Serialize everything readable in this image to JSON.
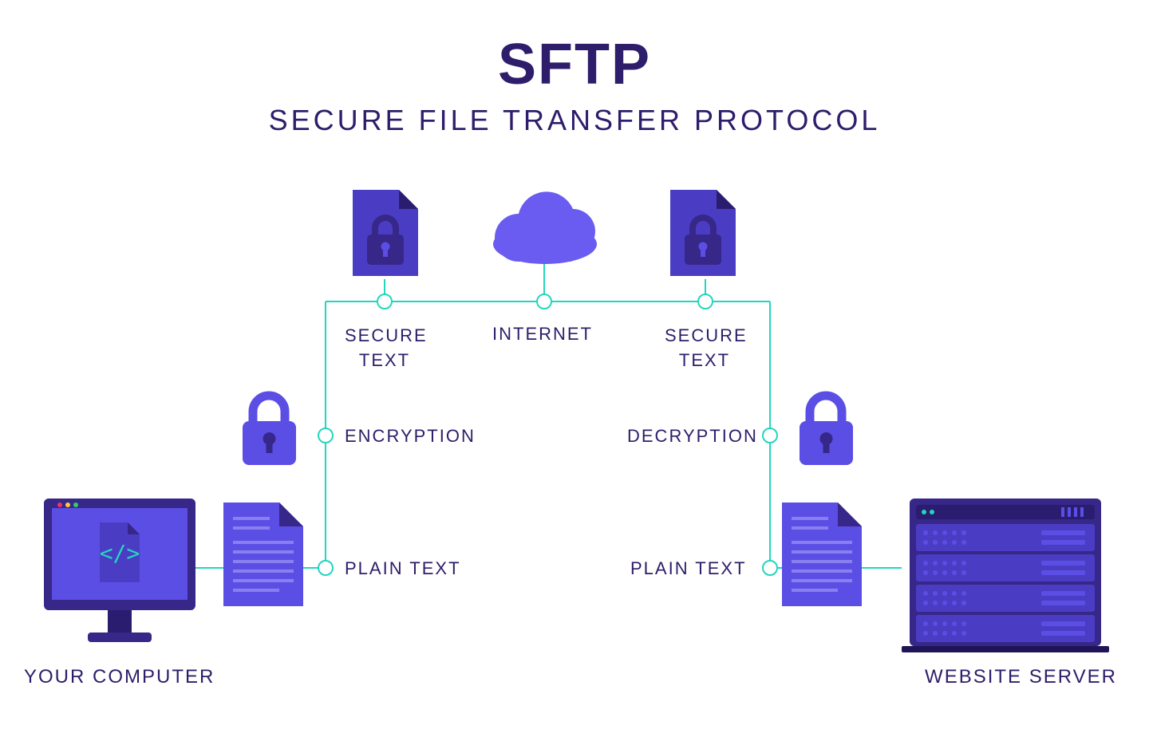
{
  "header": {
    "title": "SFTP",
    "subtitle": "SECURE FILE TRANSFER PROTOCOL"
  },
  "labels": {
    "your_computer": "YOUR COMPUTER",
    "website_server": "WEBSITE SERVER",
    "secure_text_left": "SECURE TEXT",
    "internet": "INTERNET",
    "secure_text_right": "SECURE TEXT",
    "encryption": "ENCRYPTION",
    "decryption": "DECRYPTION",
    "plain_text_left": "PLAIN TEXT",
    "plain_text_right": "PLAIN TEXT"
  },
  "graphics": {
    "icons": [
      "computer-monitor",
      "code-file",
      "plain-text-file",
      "padlock",
      "secure-file",
      "cloud",
      "server-rack"
    ],
    "line_color": "#23d6c0",
    "primary": "#5b4ee5",
    "dark": "#362788"
  }
}
